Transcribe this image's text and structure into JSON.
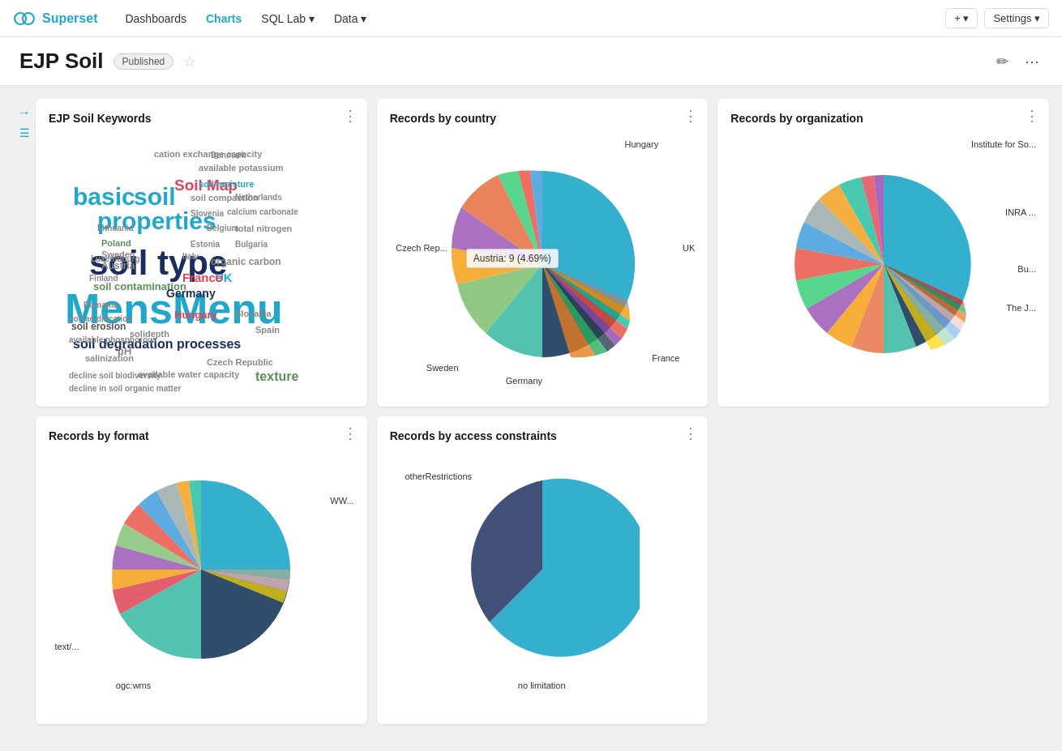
{
  "app": {
    "brand": "Superset"
  },
  "navbar": {
    "links": [
      {
        "id": "dashboards",
        "label": "Dashboards",
        "active": false,
        "hasDropdown": false
      },
      {
        "id": "charts",
        "label": "Charts",
        "active": true,
        "hasDropdown": false
      },
      {
        "id": "sqllab",
        "label": "SQL Lab",
        "active": false,
        "hasDropdown": true
      },
      {
        "id": "data",
        "label": "Data",
        "active": false,
        "hasDropdown": true
      }
    ],
    "add_button": "+",
    "settings_button": "Settings"
  },
  "page": {
    "title": "EJP Soil",
    "status": "Published",
    "edit_icon": "✏",
    "more_icon": "⋯"
  },
  "charts": {
    "word_cloud": {
      "title": "EJP Soil Keywords",
      "menu_icon": "⋮"
    },
    "records_by_country": {
      "title": "Records by country",
      "menu_icon": "⋮",
      "tooltip": "Austria: 9 (4.69%)",
      "labels": [
        "Hungary",
        "UK",
        "France",
        "Germany",
        "Sweden",
        "Czech Rep..."
      ]
    },
    "records_by_org": {
      "title": "Records by organization",
      "menu_icon": "⋮",
      "labels": [
        "Institute for So...",
        "INRA ...",
        "Bu...",
        "The J..."
      ]
    },
    "records_by_format": {
      "title": "Records by format",
      "menu_icon": "⋮",
      "labels": [
        "WW...",
        "text/...",
        "ogc:wms"
      ]
    },
    "records_by_access": {
      "title": "Records by access constraints",
      "menu_icon": "⋮",
      "labels": [
        "otherRestrictions",
        "no limitation"
      ]
    }
  }
}
